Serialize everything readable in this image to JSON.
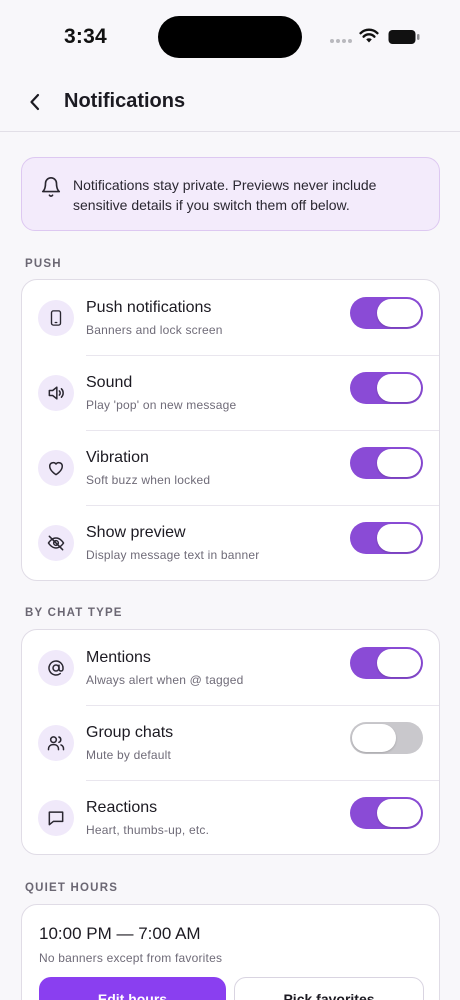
{
  "status_bar": {
    "time": "3:34"
  },
  "header": {
    "title": "Notifications",
    "back_icon": "chevron-left-icon"
  },
  "banner": {
    "icon": "bell-icon",
    "text": "Notifications stay private. Previews never include sensitive details if you switch them off below."
  },
  "sections": {
    "push": {
      "label": "PUSH",
      "rows": [
        {
          "title": "Push notifications",
          "subtitle": "Banners and lock screen",
          "icon": "phone-icon",
          "enabled": true
        },
        {
          "title": "Sound",
          "subtitle": "Play 'pop' on new message",
          "icon": "speaker-icon",
          "enabled": true
        },
        {
          "title": "Vibration",
          "subtitle": "Soft buzz when locked",
          "icon": "heart-icon",
          "enabled": true
        },
        {
          "title": "Show preview",
          "subtitle": "Display message text in banner",
          "icon": "eye-off-icon",
          "enabled": true
        }
      ]
    },
    "chat_type": {
      "label": "BY CHAT TYPE",
      "rows": [
        {
          "title": "Mentions",
          "subtitle": "Always alert when @ tagged",
          "icon": "at-icon",
          "enabled": true
        },
        {
          "title": "Group chats",
          "subtitle": "Mute by default",
          "icon": "users-icon",
          "enabled": false
        },
        {
          "title": "Reactions",
          "subtitle": "Heart, thumbs-up, etc.",
          "icon": "message-square-icon",
          "enabled": true
        }
      ]
    },
    "quiet_hours": {
      "label": "QUIET HOURS",
      "time_range": "10:00 PM — 7:00 AM",
      "subtitle": "No banners except from favorites",
      "edit_button": "Edit hours",
      "favorites_button": "Pick favorites"
    }
  },
  "colors": {
    "accent": "#8a4bd6",
    "primary_button": "#8a3ff0",
    "banner_bg": "#f3ebfb",
    "icon_bg": "#f0e9fa",
    "toggle_off": "#c9c8cc"
  }
}
